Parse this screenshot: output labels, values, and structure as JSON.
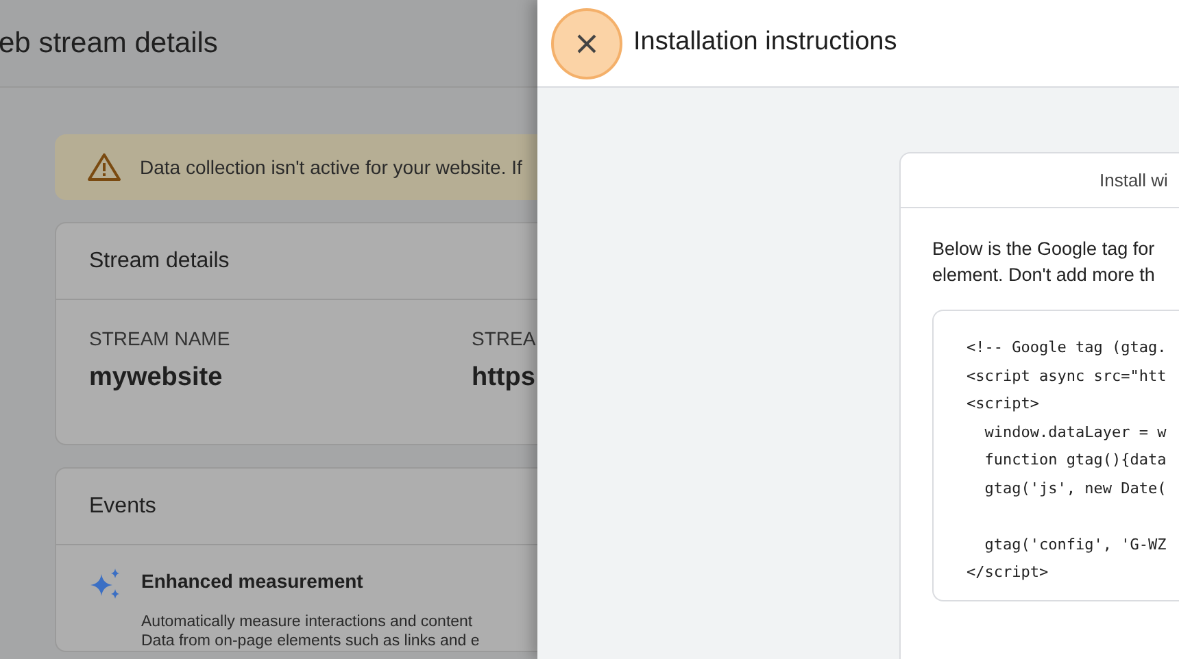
{
  "page": {
    "title": "eb stream details",
    "warning": "Data collection isn't active for your website. If",
    "stream_card": {
      "title": "Stream details",
      "fields": [
        {
          "label": "STREAM NAME",
          "value": "mywebsite"
        },
        {
          "label": "STREA",
          "value": "https"
        }
      ]
    },
    "events_card": {
      "title": "Events",
      "items": [
        {
          "title": "Enhanced measurement",
          "description": [
            "Automatically measure interactions and content",
            "Data from on-page elements such as links and e"
          ]
        }
      ]
    }
  },
  "panel": {
    "title": "Installation instructions",
    "tab": "Install wi",
    "intro": [
      "Below is the Google tag for",
      "element. Don't add more th"
    ],
    "code": "<!-- Google tag (gtag.\n<script async src=\"htt\n<script>\n  window.dataLayer = w\n  function gtag(){data\n  gtag('js', new Date(\n\n  gtag('config', 'G-WZ\n</script>"
  }
}
